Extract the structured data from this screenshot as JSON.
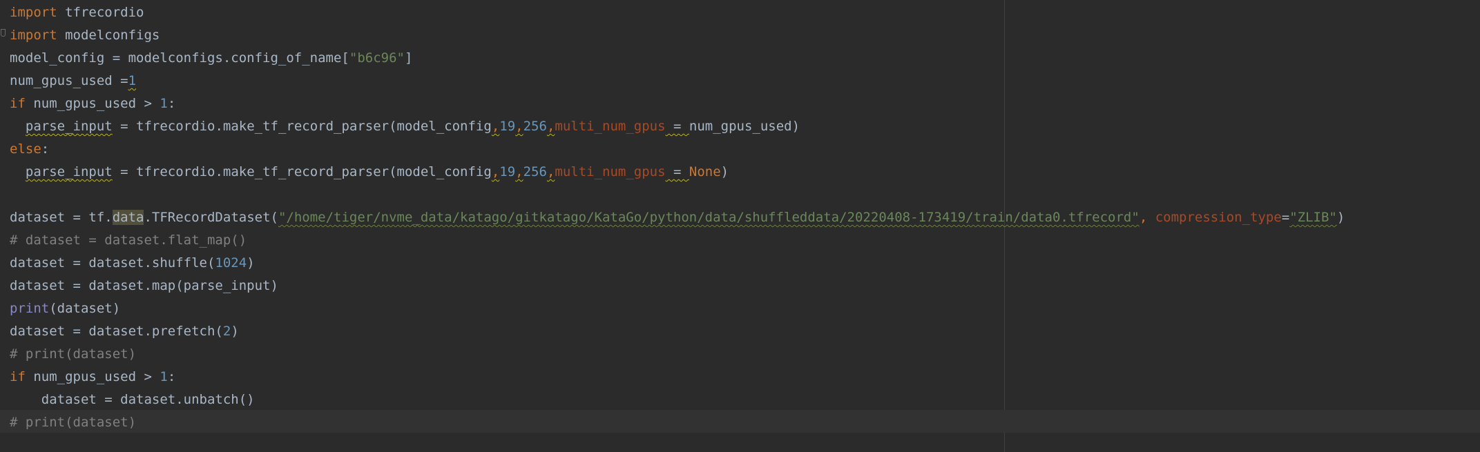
{
  "colors": {
    "background": "#2b2b2b",
    "current_line": "#323232",
    "default_text": "#a9b7c6",
    "keyword": "#cc7832",
    "string": "#6a8759",
    "number": "#6897bb",
    "parameter": "#aa4926",
    "comment": "#808080",
    "builtin": "#8888c6"
  },
  "code": {
    "l1": {
      "kw": "import",
      "rest": " tfrecordio"
    },
    "l2": {
      "kw": "import",
      "rest": " modelconfigs"
    },
    "l3": {
      "a": "model_config = modelconfigs.config_of_name[",
      "str": "\"b6c96\"",
      "b": "]"
    },
    "l4": {
      "a": "num_gpus_used =",
      "num": "1"
    },
    "l5": {
      "kw": "if",
      "a": " num_gpus_used > ",
      "num": "1",
      "b": ":"
    },
    "l6": {
      "indent": "  ",
      "var": "parse_input",
      "a": " = tfrecordio.make_tf_record_parser(model_config",
      "c1": ",",
      "n1": "19",
      "c2": ",",
      "n2": "256",
      "c3": ",",
      "param": "multi_num_gpus",
      "eq": " = ",
      "val": "num_gpus_used",
      "close": ")"
    },
    "l7": {
      "kw": "else",
      "b": ":"
    },
    "l8": {
      "indent": "  ",
      "var": "parse_input",
      "a": " = tfrecordio.make_tf_record_parser(model_config",
      "c1": ",",
      "n1": "19",
      "c2": ",",
      "n2": "256",
      "c3": ",",
      "param": "multi_num_gpus",
      "eq": " = ",
      "val": "None",
      "close": ")"
    },
    "l9": "",
    "l10": {
      "a": "dataset = tf.",
      "hl": "data",
      "b": ".TFRecordDataset(",
      "str": "\"/home/tiger/nvme_data/katago/gitkatago/KataGo/python/data/shuffleddata/20220408-173419/train/data0.tfrecord\"",
      "c": ", ",
      "param": "compression_type",
      "eq": "=",
      "str2": "\"ZLIB\"",
      "close": ")"
    },
    "l11": "# dataset = dataset.flat_map()",
    "l12": {
      "a": "dataset = dataset.shuffle(",
      "num": "1024",
      "b": ")"
    },
    "l13": "dataset = dataset.map(parse_input)",
    "l14": {
      "builtin": "print",
      "a": "(dataset)"
    },
    "l15": {
      "a": "dataset = dataset.prefetch(",
      "num": "2",
      "b": ")"
    },
    "l16": "# print(dataset)",
    "l17": {
      "kw": "if",
      "a": " num_gpus_used > ",
      "num": "1",
      "b": ":"
    },
    "l18": "    dataset = dataset.unbatch()",
    "l19": "# print(dataset)"
  }
}
